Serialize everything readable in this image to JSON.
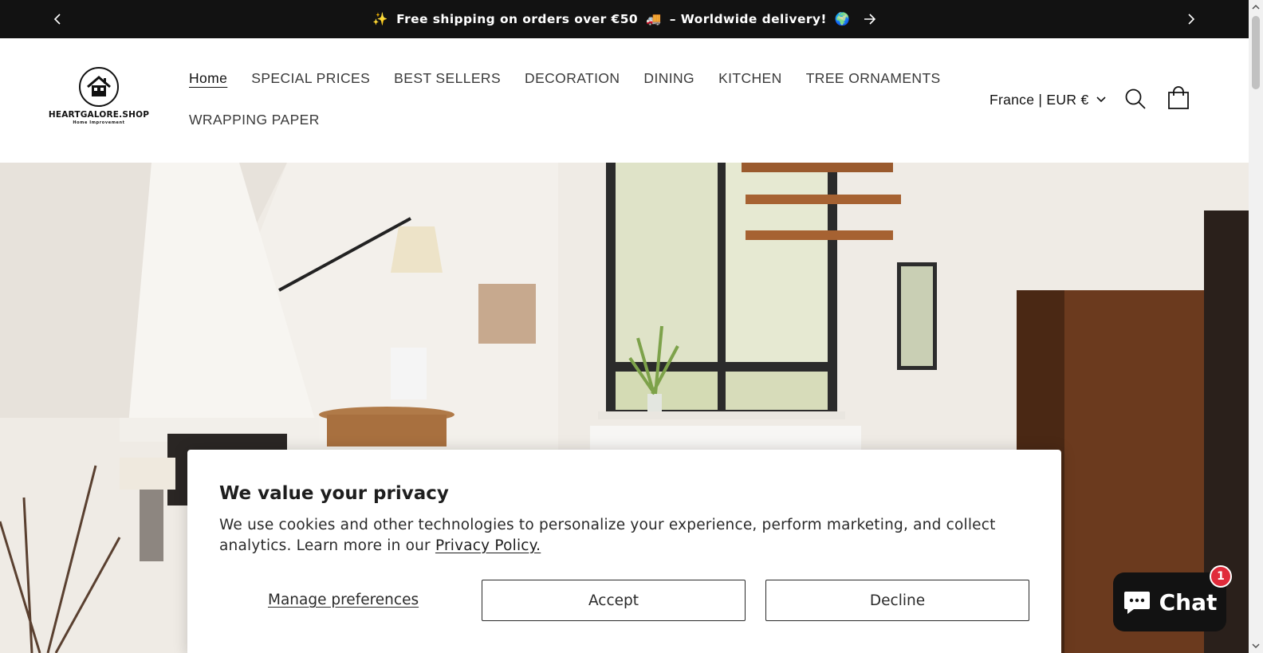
{
  "announcement": {
    "sparkle_emoji": "✨",
    "text": "Free shipping on orders over €50",
    "truck_emoji": "🚚",
    "text2": "– Worldwide delivery!",
    "globe_emoji": "🌍",
    "prev_icon": "chevron-left-icon",
    "next_icon": "chevron-right-icon"
  },
  "logo": {
    "name": "HEARTGALORE.SHOP",
    "tagline": "Home Improvement"
  },
  "nav": {
    "items": [
      {
        "label": "Home",
        "active": true
      },
      {
        "label": "SPECIAL PRICES"
      },
      {
        "label": "BEST SELLERS"
      },
      {
        "label": "DECORATION"
      },
      {
        "label": "DINING"
      },
      {
        "label": "KITCHEN"
      },
      {
        "label": "TREE ORNAMENTS"
      },
      {
        "label": "WRAPPING PAPER"
      }
    ]
  },
  "header": {
    "locale": "France | EUR €",
    "search_icon": "search-icon",
    "cart_icon": "cart-icon"
  },
  "cookie": {
    "title": "We value your privacy",
    "body": "We use cookies and other technologies to personalize your experience, perform marketing, and collect analytics. Learn more in our",
    "link": "Privacy Policy.",
    "manage": "Manage preferences",
    "accept": "Accept",
    "decline": "Decline"
  },
  "chat": {
    "label": "Chat",
    "badge": "1"
  },
  "colors": {
    "announcement_bg": "#121212",
    "chat_bg": "#121212",
    "badge": "#e02b3b"
  }
}
